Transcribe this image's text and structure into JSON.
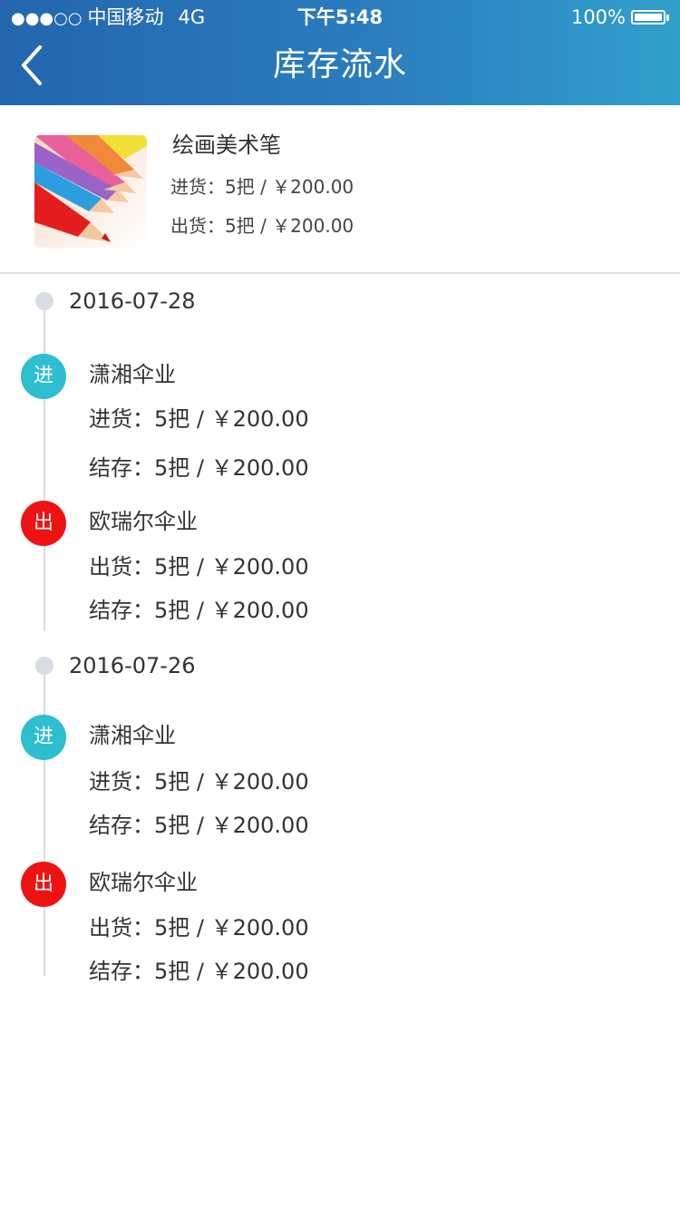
{
  "status_bar": {
    "signal": "●●●○○",
    "carrier": "中国移动",
    "network": "4G",
    "time": "下午5:48",
    "battery": "100%"
  },
  "nav": {
    "title": "库存流水",
    "back_icon": "chevron-left-icon"
  },
  "product": {
    "name": "绘画美术笔",
    "image_icon": "colored-pencils-image",
    "in_line": "进货：5把 / ￥200.00",
    "out_line": "出货：5把 / ￥200.00"
  },
  "colors": {
    "header_start": "#2366ae",
    "header_end": "#31a0cc",
    "badge_in": "#2fbdd0",
    "badge_out": "#ee1313",
    "timeline": "#d9dde3"
  },
  "timeline": [
    {
      "date": "2016-07-28",
      "entries": [
        {
          "badge": "进",
          "type": "in",
          "name": "潇湘伞业",
          "line1": "进货：5把 / ￥200.00",
          "line2": "结存：5把 / ￥200.00"
        },
        {
          "badge": "出",
          "type": "out",
          "name": "欧瑞尔伞业",
          "line1": "出货：5把 / ￥200.00",
          "line2": "结存：5把 / ￥200.00"
        }
      ]
    },
    {
      "date": "2016-07-26",
      "entries": [
        {
          "badge": "进",
          "type": "in",
          "name": "潇湘伞业",
          "line1": "进货：5把 / ￥200.00",
          "line2": "结存：5把 / ￥200.00"
        },
        {
          "badge": "出",
          "type": "out",
          "name": "欧瑞尔伞业",
          "line1": "出货：5把 / ￥200.00",
          "line2": "结存：5把 / ￥200.00"
        }
      ]
    }
  ]
}
